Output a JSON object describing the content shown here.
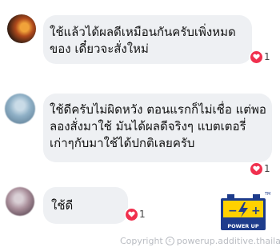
{
  "comments": [
    {
      "lines": [
        "ใช้แล้วได้ผลดีเหมือนกันครับเพิ่งหมด",
        "ของ เดี๋ยวจะสั่งใหม่"
      ],
      "reaction_count": "1"
    },
    {
      "lines": [
        "ใช้ดีครับไม่ผิดหวัง ตอนแรกก็ไม่เชื่อ แต่พอ",
        "ลองสั่งมาใช้ มันได้ผลดีจริงๆ แบตเตอรี่",
        "เก่าๆกับมาใช้ได้ปกติเลยครับ"
      ],
      "reaction_count": "1"
    },
    {
      "lines": [
        "ใช้ดี"
      ],
      "reaction_count": "1"
    }
  ],
  "logo": {
    "tm": "TM",
    "minus": "−",
    "plus": "+",
    "text": "POWER UP"
  },
  "copyright": {
    "label": "Copyright",
    "symbol": "c",
    "site": "powerup.additive.thailand"
  },
  "colors": {
    "bubble": "#eef0f3",
    "heart": "#f0304e",
    "logo_blue": "#1e3c8c",
    "logo_yellow": "#ffd100"
  }
}
